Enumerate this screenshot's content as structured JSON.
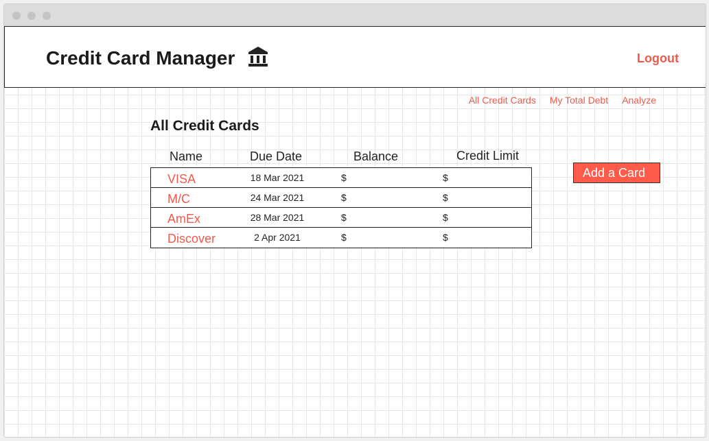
{
  "app": {
    "title": "Credit Card Manager",
    "logout_label": "Logout",
    "accent_color": "#f15a4a"
  },
  "icons": {
    "bank": "bank-building-icon"
  },
  "nav": {
    "items": [
      {
        "label": "All Credit Cards"
      },
      {
        "label": "My Total Debt"
      },
      {
        "label": "Analyze"
      }
    ]
  },
  "main": {
    "section_title": "All Credit Cards",
    "columns": {
      "name": "Name",
      "due_date": "Due Date",
      "balance": "Balance",
      "credit_limit": "Credit Limit"
    },
    "cards": [
      {
        "name": "VISA",
        "due_date": "18 Mar 2021",
        "balance": "$",
        "credit_limit": "$"
      },
      {
        "name": "M/C",
        "due_date": "24 Mar 2021",
        "balance": "$",
        "credit_limit": "$"
      },
      {
        "name": "AmEx",
        "due_date": "28 Mar 2021",
        "balance": "$",
        "credit_limit": "$"
      },
      {
        "name": "Discover",
        "due_date": "2 Apr 2021",
        "balance": "$",
        "credit_limit": "$"
      }
    ],
    "add_button_label": "Add a Card"
  }
}
